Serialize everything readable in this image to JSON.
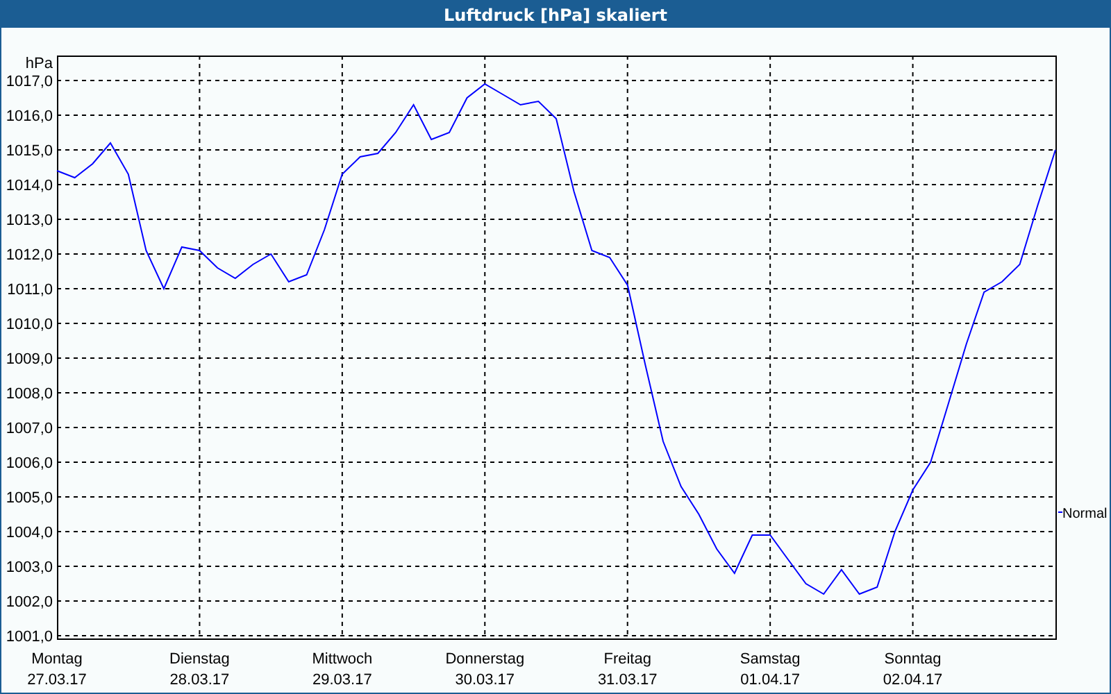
{
  "chart_data": {
    "type": "line",
    "title": "Luftdruck [hPa] skaliert",
    "ylabel": "hPa",
    "grid": true,
    "ylim": [
      1001,
      1017
    ],
    "categories": [
      "Montag 27.03.17",
      null,
      null,
      null,
      null,
      null,
      null,
      null,
      "Dienstag 28.03.17",
      null,
      null,
      null,
      null,
      null,
      null,
      null,
      "Mittwoch 29.03.17",
      null,
      null,
      null,
      null,
      null,
      null,
      null,
      "Donnerstag 30.03.17",
      null,
      null,
      null,
      null,
      null,
      null,
      null,
      "Freitag 31.03.17",
      null,
      null,
      null,
      null,
      null,
      null,
      null,
      "Samstag 01.04.17",
      null,
      null,
      null,
      null,
      null,
      null,
      null,
      "Sonntag 02.04.17",
      null,
      null,
      null,
      null,
      null,
      null,
      null,
      null
    ],
    "yticks": [
      {
        "value": 1001,
        "label": "1001,0"
      },
      {
        "value": 1002,
        "label": "1002,0"
      },
      {
        "value": 1003,
        "label": "1003,0"
      },
      {
        "value": 1004,
        "label": "1004,0"
      },
      {
        "value": 1005,
        "label": "1005,0"
      },
      {
        "value": 1006,
        "label": "1006,0"
      },
      {
        "value": 1007,
        "label": "1007,0"
      },
      {
        "value": 1008,
        "label": "1008,0"
      },
      {
        "value": 1009,
        "label": "1009,0"
      },
      {
        "value": 1010,
        "label": "1010,0"
      },
      {
        "value": 1011,
        "label": "1011,0"
      },
      {
        "value": 1012,
        "label": "1012,0"
      },
      {
        "value": 1013,
        "label": "1013,0"
      },
      {
        "value": 1014,
        "label": "1014,0"
      },
      {
        "value": 1015,
        "label": "1015,0"
      },
      {
        "value": 1016,
        "label": "1016,0"
      },
      {
        "value": 1017,
        "label": "1017,0"
      }
    ],
    "series": [
      {
        "name": "Normal",
        "color": "#0000ff",
        "values": [
          1014.4,
          1014.2,
          1014.6,
          1015.2,
          1014.3,
          1012.1,
          1011.0,
          1012.2,
          1012.1,
          1011.6,
          1011.3,
          1011.7,
          1012.0,
          1011.2,
          1011.4,
          1012.7,
          1014.3,
          1014.8,
          1014.9,
          1015.5,
          1016.3,
          1015.3,
          1015.5,
          1016.5,
          1016.9,
          1016.6,
          1016.3,
          1016.4,
          1015.9,
          1013.8,
          1012.1,
          1011.9,
          1011.1,
          1008.8,
          1006.6,
          1005.3,
          1004.5,
          1003.5,
          1002.8,
          1003.9,
          1003.9,
          1003.2,
          1002.5,
          1002.2,
          1002.9,
          1002.2,
          1002.4,
          1004.0,
          1005.2,
          1006.0,
          1007.7,
          1009.4,
          1010.9,
          1011.2,
          1011.7,
          1013.4,
          1015.0
        ]
      }
    ]
  }
}
